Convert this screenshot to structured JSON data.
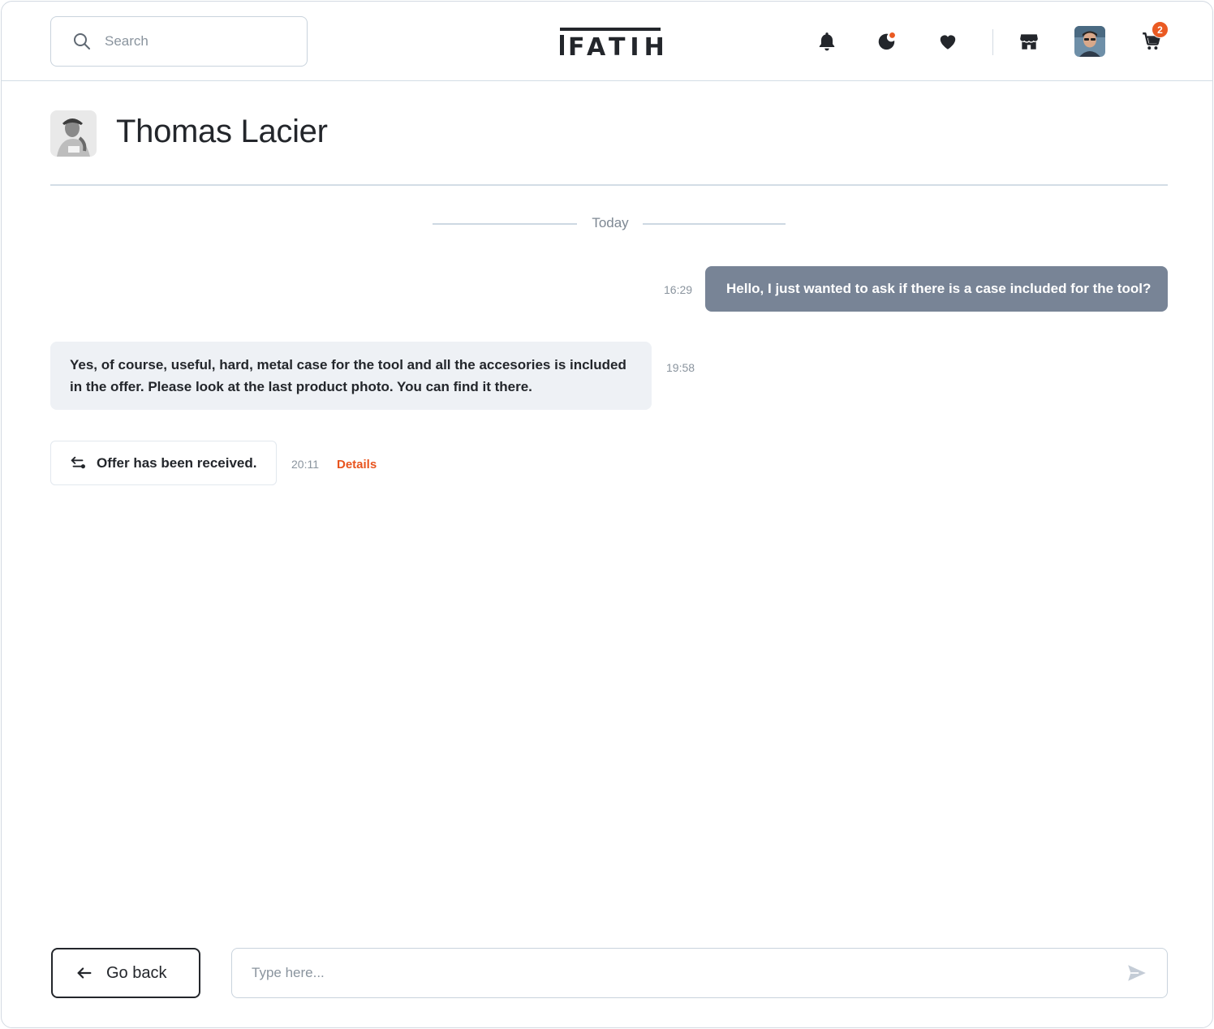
{
  "header": {
    "search": {
      "placeholder": "Search",
      "icon": "search-icon"
    },
    "logo": "iFATIH",
    "icons": [
      "bell-icon",
      "chat-notification-icon",
      "heart-icon",
      "store-icon",
      "user-avatar",
      "cart-icon"
    ],
    "cart_count": "2",
    "accent_color": "#ea5a22"
  },
  "contact": {
    "name": "Thomas Lacier"
  },
  "conversation": {
    "day_label": "Today",
    "messages": [
      {
        "direction": "outgoing",
        "time": "16:29",
        "text": "Hello, I just wanted to ask if there is a case included for the tool?"
      },
      {
        "direction": "incoming",
        "time": "19:58",
        "text": "Yes, of course, useful, hard, metal case for the tool and all the accesories is included in the offer. Please look at the last product photo. You can find it there."
      }
    ],
    "offer": {
      "text": "Offer has been received.",
      "time": "20:11",
      "link_label": "Details",
      "icon": "transfer-icon"
    }
  },
  "footer": {
    "go_back_label": "Go back",
    "composer_placeholder": "Type here...",
    "send_icon": "send-icon"
  }
}
